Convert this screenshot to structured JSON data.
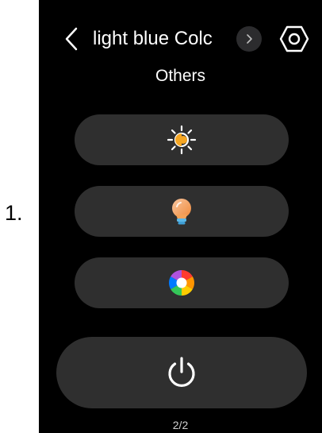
{
  "step": {
    "label": "1."
  },
  "header": {
    "device_name": "light blue Colc",
    "section_title": "Others"
  },
  "controls": [
    {
      "id": "brightness",
      "icon": "brightness-icon"
    },
    {
      "id": "color-temperature",
      "icon": "bulb-icon"
    },
    {
      "id": "color",
      "icon": "color-wheel-icon"
    },
    {
      "id": "power",
      "icon": "power-icon"
    }
  ],
  "pagination": {
    "text": "2/2"
  },
  "colors": {
    "background": "#000000",
    "pill": "#2f2f2f",
    "next_button": "#2c2c2e",
    "text": "#ffffff",
    "brightness_accent": "#f5a623",
    "bulb_accent": "#f4a259",
    "bulb_base": "#5bb8e8"
  }
}
